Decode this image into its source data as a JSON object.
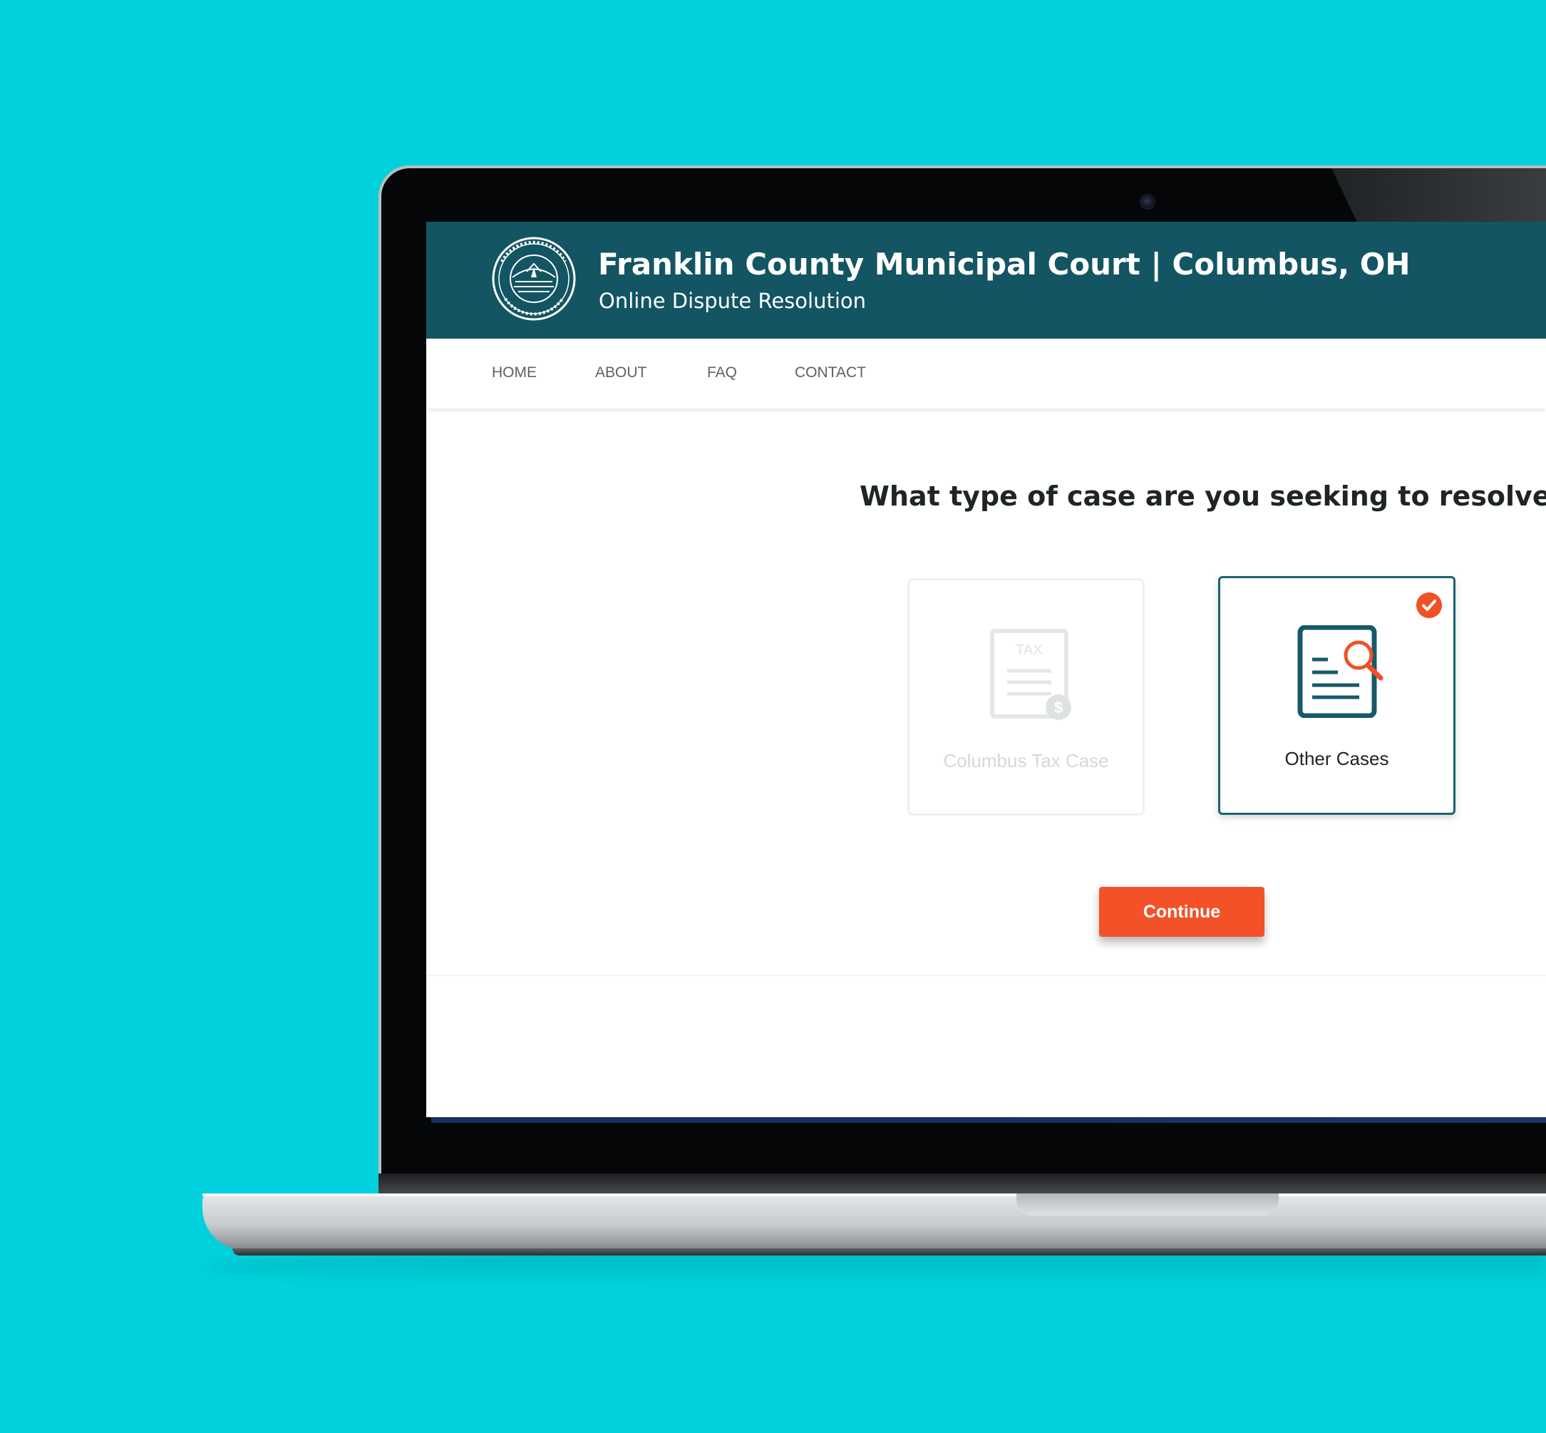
{
  "header": {
    "title": "Franklin County Municipal Court | Columbus, OH",
    "subtitle": "Online Dispute Resolution",
    "seal_icon": "county-seal-icon"
  },
  "nav": {
    "items": [
      {
        "label": "HOME"
      },
      {
        "label": "ABOUT"
      },
      {
        "label": "FAQ"
      },
      {
        "label": "CONTACT"
      }
    ]
  },
  "main": {
    "question": "What type of case are you seeking to resolve?",
    "options": [
      {
        "label": "Columbus Tax Case",
        "icon": "tax-document-icon",
        "icon_text": "TAX",
        "state": "disabled"
      },
      {
        "label": "Other Cases",
        "icon": "document-search-icon",
        "state": "selected"
      }
    ],
    "continue_label": "Continue"
  },
  "colors": {
    "background": "#00d1dc",
    "header": "#135562",
    "accent": "#f35228",
    "selected_border": "#1a6374",
    "disabled_text": "#d4d8da"
  }
}
